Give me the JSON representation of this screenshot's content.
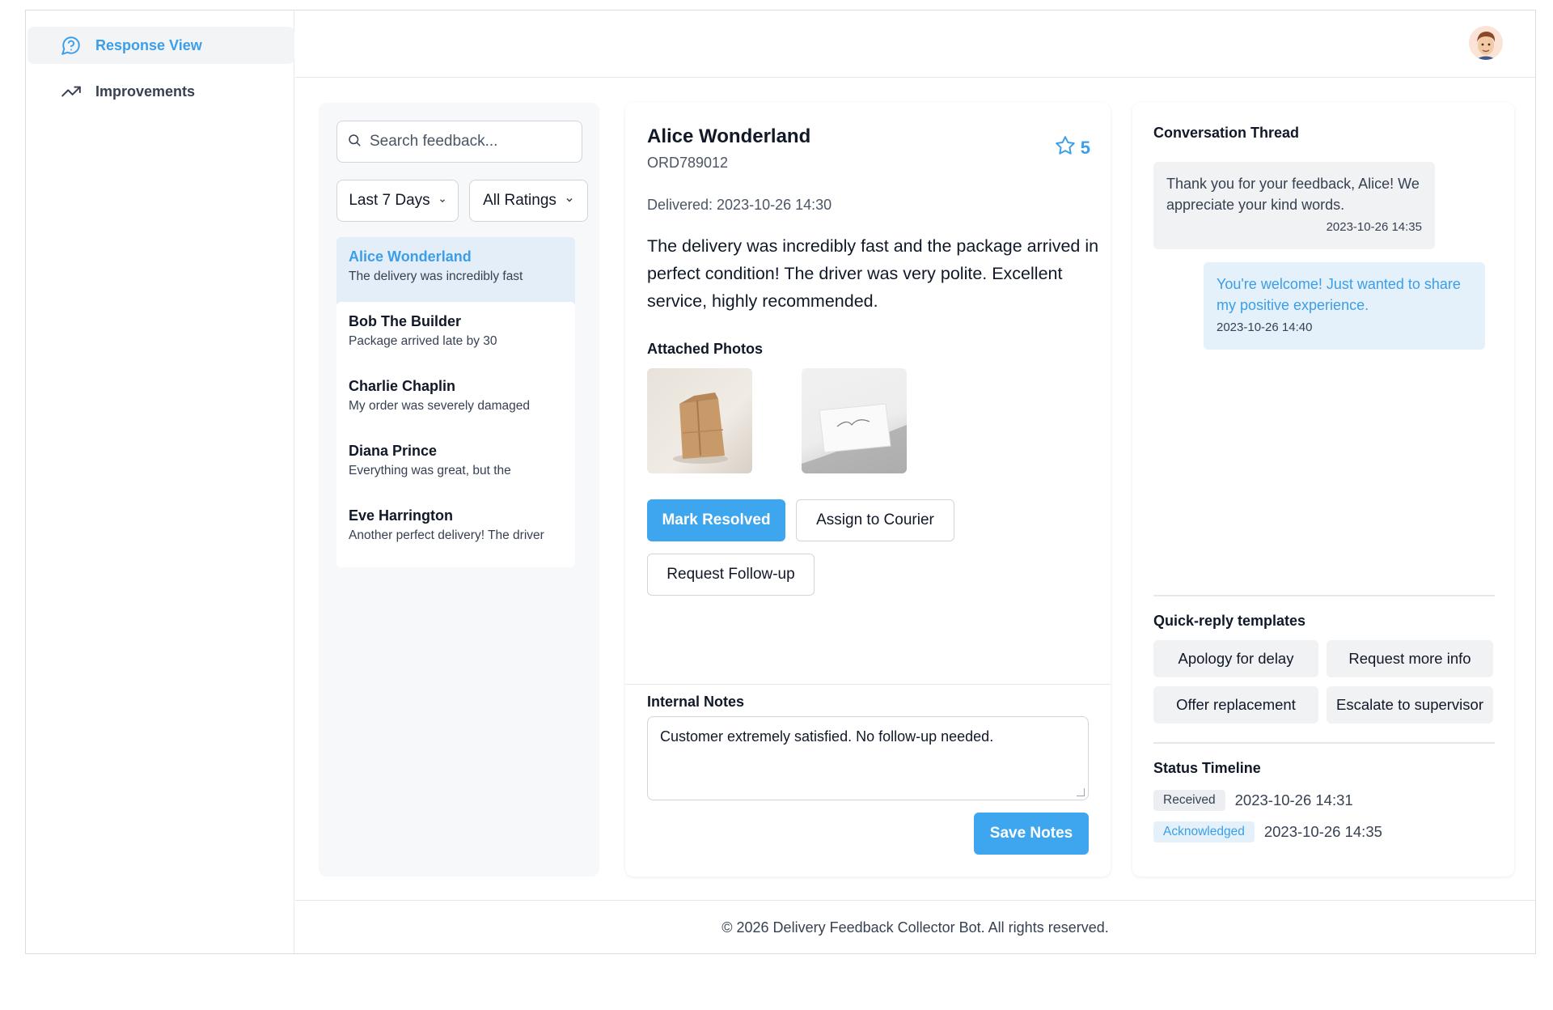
{
  "sidebar": {
    "items": [
      {
        "label": "Response View",
        "icon": "chat-question-icon",
        "active": true
      },
      {
        "label": "Improvements",
        "icon": "trending-up-icon",
        "active": false
      }
    ]
  },
  "topbar": {
    "avatar_icon": "user-avatar"
  },
  "list": {
    "search_placeholder": "Search feedback...",
    "date_filter": "Last 7 Days",
    "rating_filter": "All Ratings",
    "items": [
      {
        "name": "Alice Wonderland",
        "snippet": "The delivery was incredibly fast"
      },
      {
        "name": "Bob The Builder",
        "snippet": "Package arrived late by 30"
      },
      {
        "name": "Charlie Chaplin",
        "snippet": "My order was severely damaged"
      },
      {
        "name": "Diana Prince",
        "snippet": "Everything was great, but the"
      },
      {
        "name": "Eve Harrington",
        "snippet": "Another perfect delivery! The driver"
      }
    ]
  },
  "detail": {
    "name": "Alice Wonderland",
    "order_id": "ORD789012",
    "rating": "5",
    "delivered": "Delivered: 2023-10-26 14:30",
    "text": "The delivery was incredibly fast and the package arrived in perfect condition! The driver was very polite. Excellent service, highly recommended.",
    "photos_label": "Attached Photos",
    "actions": {
      "resolve": "Mark Resolved",
      "assign": "Assign to Courier",
      "follow": "Request Follow-up"
    },
    "notes_label": "Internal Notes",
    "notes_value": "Customer extremely satisfied. No follow-up needed.",
    "save_label": "Save Notes"
  },
  "thread": {
    "title": "Conversation Thread",
    "messages": [
      {
        "text": "Thank you for your feedback, Alice! We appreciate your kind words.",
        "time": "2023-10-26 14:35"
      },
      {
        "text": "You're welcome! Just wanted to share my positive experience.",
        "time": "2023-10-26 14:40"
      }
    ],
    "templates_title": "Quick-reply templates",
    "templates": [
      "Apology for delay",
      "Request more info",
      "Offer replacement",
      "Escalate to supervisor"
    ],
    "timeline_title": "Status Timeline",
    "timeline": [
      {
        "status": "Received",
        "time": "2023-10-26 14:31"
      },
      {
        "status": "Acknowledged",
        "time": "2023-10-26 14:35"
      }
    ]
  },
  "footer": "© 2026 Delivery Feedback Collector Bot. All rights reserved.",
  "colors": {
    "accent": "#3ea6ef",
    "accent_text": "#3b9ee8",
    "selected_bg": "#e3eef8"
  }
}
